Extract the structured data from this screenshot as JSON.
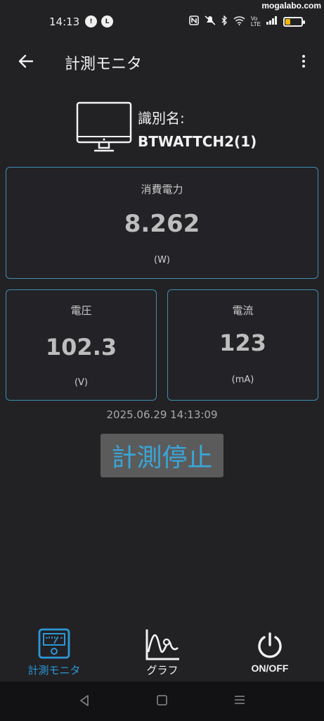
{
  "status_bar": {
    "time": "14:13",
    "left_icons": [
      "notification-icon",
      "line-icon"
    ],
    "right_icons": [
      "nfc-icon",
      "mute-icon",
      "bluetooth-icon",
      "wifi-icon",
      "volte-icon",
      "signal-icon",
      "battery-icon"
    ],
    "battery_level": 0.3,
    "battery_color": "#f2b705",
    "watermark": "mogalabo.com"
  },
  "app_bar": {
    "back_icon": "arrow-left-icon",
    "title": "計測モニタ",
    "more_icon": "more-vertical-icon"
  },
  "device": {
    "icon": "monitor-icon",
    "label": "識別名:",
    "name": "BTWATTCH2(1)"
  },
  "power": {
    "label": "消費電力",
    "value": "8.262",
    "unit": "(W)"
  },
  "voltage": {
    "label": "電圧",
    "value": "102.3",
    "unit": "(V)"
  },
  "current": {
    "label": "電流",
    "value": "123",
    "unit": "(mA)"
  },
  "timestamp": "2025.06.29 14:13:09",
  "stop_button": {
    "label": "計測停止"
  },
  "bottom_nav": {
    "items": [
      {
        "label": "計測モニタ",
        "icon": "meter-icon",
        "active": true
      },
      {
        "label": "グラフ",
        "icon": "graph-icon",
        "active": false
      },
      {
        "label": "ON/OFF",
        "icon": "power-icon",
        "active": false
      }
    ]
  },
  "system_nav": [
    "back-triangle-icon",
    "home-square-icon",
    "recents-icon"
  ],
  "colors": {
    "background": "#222124",
    "card_border": "#3d8fb3",
    "accent": "#2c97d6",
    "button_bg": "#5b5b5b",
    "button_text": "#3aa6d9"
  }
}
